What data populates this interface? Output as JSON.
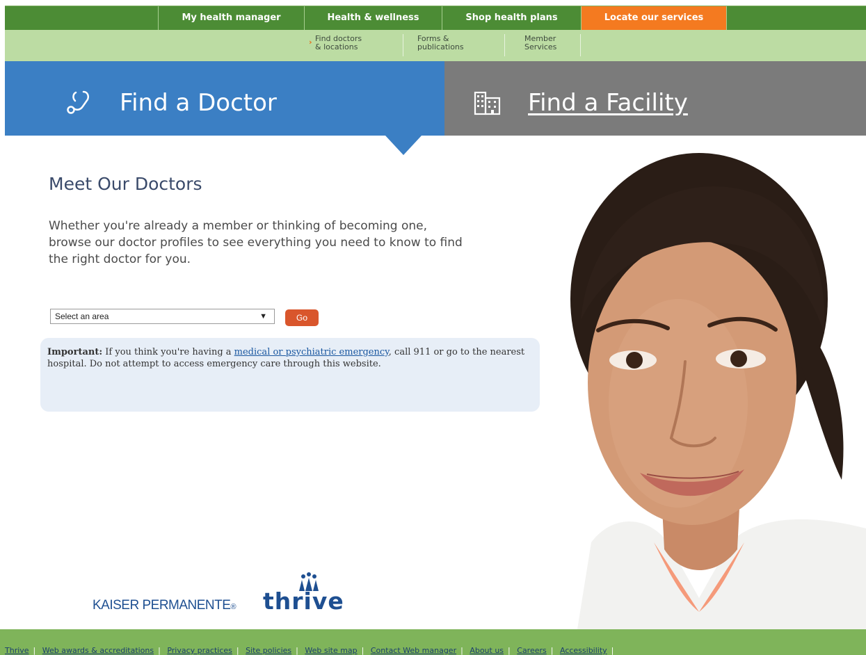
{
  "top_nav": {
    "tabs": [
      {
        "label": "My health manager"
      },
      {
        "label": "Health & wellness"
      },
      {
        "label": "Shop health plans"
      },
      {
        "label": "Locate our services",
        "active": true
      }
    ],
    "active_color": "#f47a20",
    "bar_color": "#4c8c35"
  },
  "sub_nav": {
    "items": [
      {
        "line1": "Find doctors",
        "line2": "& locations",
        "active": true
      },
      {
        "line1": "Forms &",
        "line2": "publications"
      },
      {
        "line1": "Member",
        "line2": "Services"
      }
    ]
  },
  "find": {
    "doctor_label": "Find a Doctor",
    "facility_label": "Find a Facility",
    "doctor_color": "#3b7fc4",
    "facility_color": "#7b7b7b"
  },
  "content": {
    "heading": "Meet Our Doctors",
    "intro": "Whether you're already a member or thinking of becoming one, browse our doctor profiles to see everything you need to know to find the right doctor for you.",
    "select_value": "Select an area",
    "go_label": "Go"
  },
  "notice": {
    "bold": "Important:",
    "before_link": " If you think you're having a ",
    "link": "medical or psychiatric emergency",
    "after_link": ", call 911 or go to the nearest hospital. Do not attempt to access emergency care through this website."
  },
  "logo": {
    "kp": "KAISER PERMANENTE",
    "registered": "®",
    "thrive": "thrive"
  },
  "footer": {
    "links": [
      "Thrive",
      "Web awards & accreditations",
      "Privacy practices",
      "Site policies",
      "Web site map",
      "Contact Web manager",
      "About us",
      "Careers",
      "Accessibility"
    ]
  },
  "icons": {
    "doctor": "stethoscope-icon",
    "facility": "building-icon"
  }
}
